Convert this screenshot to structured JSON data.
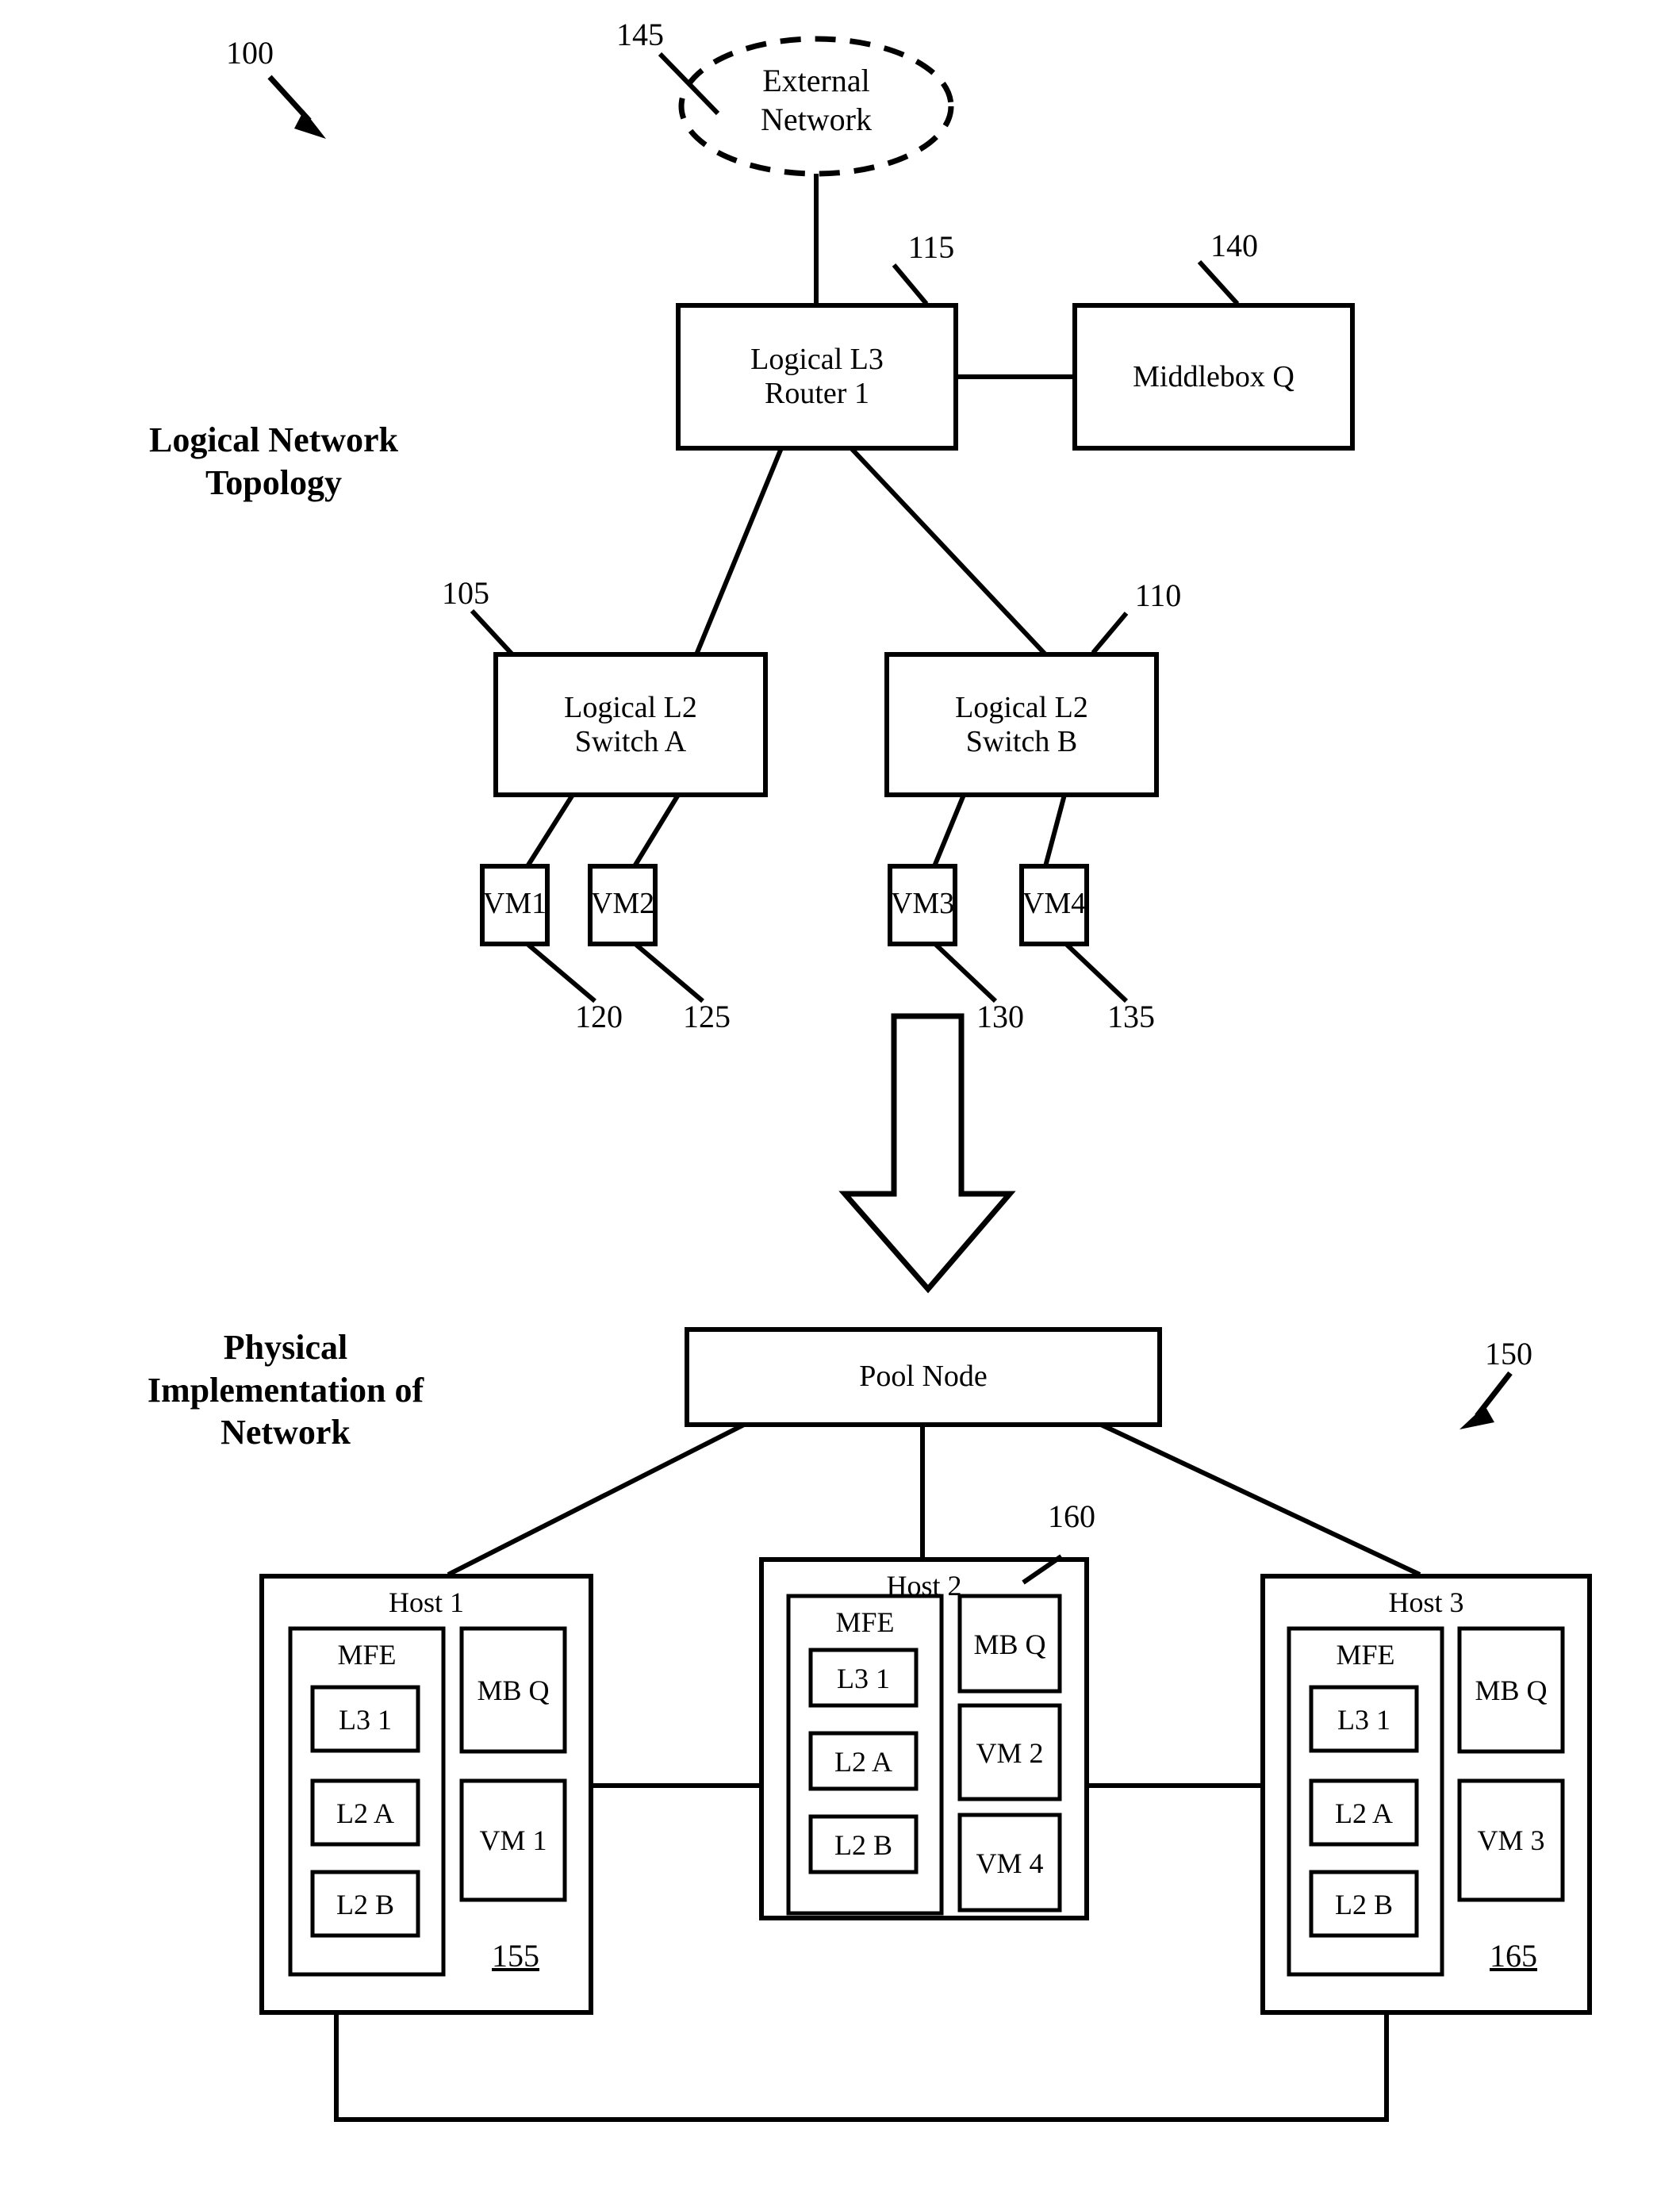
{
  "figure": {
    "ref": "100",
    "sections": [
      {
        "id": "logical",
        "heading": "Logical Network\nTopology"
      },
      {
        "id": "physical",
        "heading": "Physical\nImplementation of\nNetwork"
      }
    ]
  },
  "logical": {
    "cloud": {
      "label": "External\nNetwork",
      "ref": "145"
    },
    "router": {
      "label": "Logical L3\nRouter 1",
      "ref": "115"
    },
    "middlebox": {
      "label": "Middlebox Q",
      "ref": "140"
    },
    "switch_a": {
      "label": "Logical L2\nSwitch A",
      "ref": "105"
    },
    "switch_b": {
      "label": "Logical L2\nSwitch B",
      "ref": "110"
    },
    "vms": [
      {
        "label": "VM1",
        "ref": "120"
      },
      {
        "label": "VM2",
        "ref": "125"
      },
      {
        "label": "VM3",
        "ref": "130"
      },
      {
        "label": "VM4",
        "ref": "135"
      }
    ]
  },
  "physical": {
    "ref": "150",
    "pool_node": {
      "label": "Pool Node"
    },
    "hosts": [
      {
        "title": "Host 1",
        "ref": "155",
        "mfe": {
          "title": "MFE",
          "elements": [
            "L3 1",
            "L2 A",
            "L2 B"
          ]
        },
        "right_boxes": [
          "MB Q",
          "VM 1"
        ]
      },
      {
        "title": "Host 2",
        "ref": "160",
        "mfe": {
          "title": "MFE",
          "elements": [
            "L3 1",
            "L2 A",
            "L2 B"
          ]
        },
        "right_boxes": [
          "MB Q",
          "VM 2",
          "VM 4"
        ]
      },
      {
        "title": "Host 3",
        "ref": "165",
        "mfe": {
          "title": "MFE",
          "elements": [
            "L3 1",
            "L2 A",
            "L2 B"
          ]
        },
        "right_boxes": [
          "MB Q",
          "VM 3"
        ]
      }
    ]
  },
  "colors": {
    "stroke": "#000000",
    "background": "#ffffff"
  }
}
